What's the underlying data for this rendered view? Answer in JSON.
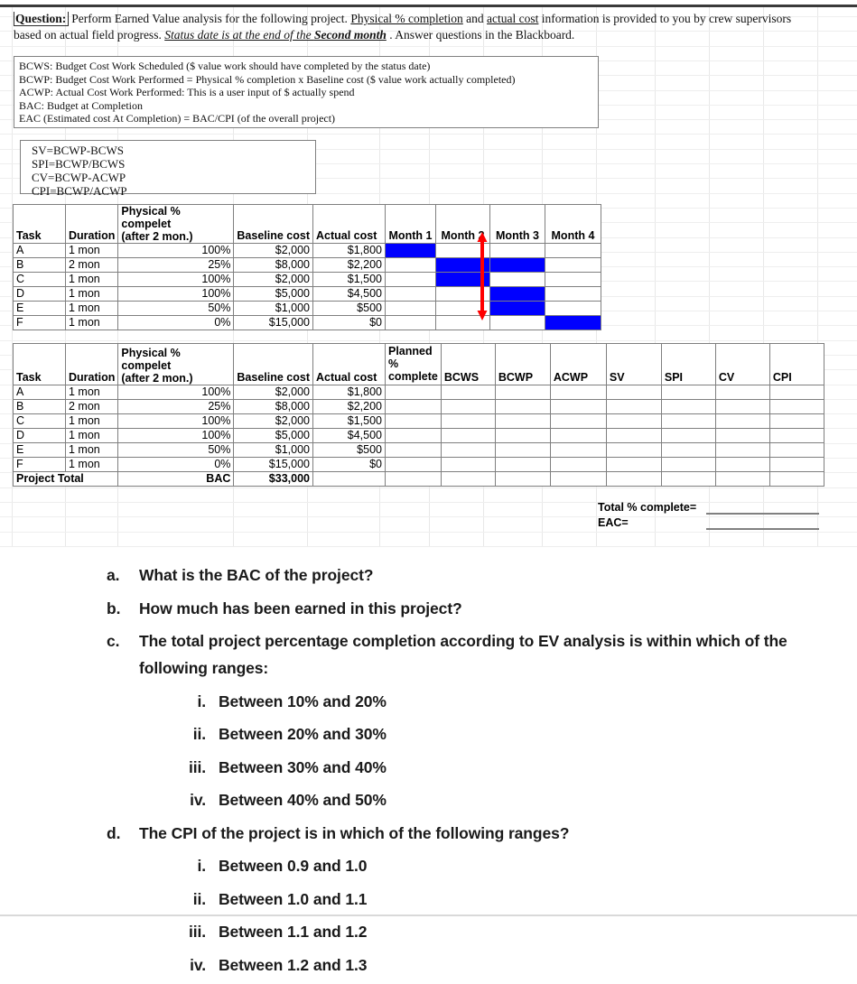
{
  "question": {
    "label": "Question:",
    "line1_a": "Perform Earned Value analysis for the following project. ",
    "line1_u1": "Physical % completion",
    "line1_b": " and ",
    "line1_u2": "actual cost",
    "line1_c": " information is provided to you by crew supervisors",
    "line2_a": "based on actual field progress. ",
    "line2_i1": "Status date is at the end of the ",
    "line2_i2": "Second month",
    "line2_b": " . Answer questions in the Blackboard."
  },
  "definitions": [
    "BCWS: Budget Cost Work Scheduled ($ value work should have completed by the status date)",
    "BCWP: Budget Cost Work Performed = Physical % completion x Baseline cost ($ value work actually completed)",
    "ACWP: Actual Cost Work Performed: This is a user input of $ actually spend",
    "BAC: Budget at Completion",
    "EAC (Estimated cost At Completion) = BAC/CPI (of the overall project)"
  ],
  "formulas": [
    "SV=BCWP-BCWS",
    "SPI=BCWP/BCWS",
    "CV=BCWP-ACWP",
    "CPI=BCWP/ACWP"
  ],
  "gantt_table": {
    "headers": {
      "task": "Task",
      "duration": "Duration",
      "pct_line1": "Physical % compelet",
      "pct_line2": "(after 2 mon.)",
      "baseline": "Baseline cost",
      "actual": "Actual cost",
      "months": [
        "Month 1",
        "Month 2",
        "Month 3",
        "Month 4"
      ]
    },
    "rows": [
      {
        "task": "A",
        "duration": "1 mon",
        "pct": "100%",
        "baseline": "$2,000",
        "actual": "$1,800",
        "bars": [
          true,
          false,
          false,
          false
        ]
      },
      {
        "task": "B",
        "duration": "2 mon",
        "pct": "25%",
        "baseline": "$8,000",
        "actual": "$2,200",
        "bars": [
          false,
          true,
          true,
          false
        ]
      },
      {
        "task": "C",
        "duration": "1 mon",
        "pct": "100%",
        "baseline": "$2,000",
        "actual": "$1,500",
        "bars": [
          false,
          true,
          false,
          false
        ]
      },
      {
        "task": "D",
        "duration": "1 mon",
        "pct": "100%",
        "baseline": "$5,000",
        "actual": "$4,500",
        "bars": [
          false,
          false,
          true,
          false
        ]
      },
      {
        "task": "E",
        "duration": "1 mon",
        "pct": "50%",
        "baseline": "$1,000",
        "actual": "$500",
        "bars": [
          false,
          false,
          true,
          false
        ]
      },
      {
        "task": "F",
        "duration": "1 mon",
        "pct": "0%",
        "baseline": "$15,000",
        "actual": "$0",
        "bars": [
          false,
          false,
          false,
          true
        ]
      }
    ],
    "bar_color": "#0000FF",
    "status_line_color": "#FF0000"
  },
  "ev_table": {
    "headers": {
      "task": "Task",
      "duration": "Duration",
      "pct_line1": "Physical % compelet",
      "pct_line2": "(after 2 mon.)",
      "baseline": "Baseline cost",
      "actual": "Actual cost",
      "planned_line1": "Planned",
      "planned_line2": "%",
      "planned_line3": "complete",
      "bcws": "BCWS",
      "bcwp": "BCWP",
      "acwp": "ACWP",
      "sv": "SV",
      "spi": "SPI",
      "cv": "CV",
      "cpi": "CPI"
    },
    "rows": [
      {
        "task": "A",
        "duration": "1 mon",
        "pct": "100%",
        "baseline": "$2,000",
        "actual": "$1,800"
      },
      {
        "task": "B",
        "duration": "2 mon",
        "pct": "25%",
        "baseline": "$8,000",
        "actual": "$2,200"
      },
      {
        "task": "C",
        "duration": "1 mon",
        "pct": "100%",
        "baseline": "$2,000",
        "actual": "$1,500"
      },
      {
        "task": "D",
        "duration": "1 mon",
        "pct": "100%",
        "baseline": "$5,000",
        "actual": "$4,500"
      },
      {
        "task": "E",
        "duration": "1 mon",
        "pct": "50%",
        "baseline": "$1,000",
        "actual": "$500"
      },
      {
        "task": "F",
        "duration": "1 mon",
        "pct": "0%",
        "baseline": "$15,000",
        "actual": "$0"
      }
    ],
    "total_row": {
      "label": "Project Total",
      "duration": "",
      "pct": "BAC",
      "baseline": "$33,000",
      "actual": ""
    }
  },
  "totals": {
    "total_pct_label": "Total % complete=",
    "eac_label": "EAC=",
    "total_pct_value": "",
    "eac_value": ""
  },
  "questions": [
    {
      "mark": "a.",
      "text": "What is the BAC of the project?",
      "level": 1
    },
    {
      "mark": "b.",
      "text": "How much has been earned in this project?",
      "level": 1
    },
    {
      "mark": "c.",
      "text": "The total project percentage completion according to EV analysis is within which of the following ranges:",
      "level": 1
    },
    {
      "mark": "i.",
      "text": "Between 10% and 20%",
      "level": 2
    },
    {
      "mark": "ii.",
      "text": "Between 20% and 30%",
      "level": 2
    },
    {
      "mark": "iii.",
      "text": "Between 30% and 40%",
      "level": 2
    },
    {
      "mark": "iv.",
      "text": "Between 40% and 50%",
      "level": 2
    },
    {
      "mark": "d.",
      "text": "The CPI of the project is in which of the following ranges?",
      "level": 1
    },
    {
      "mark": "i.",
      "text": "Between 0.9 and 1.0",
      "level": 2
    },
    {
      "mark": "ii.",
      "text": "Between 1.0 and 1.1",
      "level": 2
    },
    {
      "mark": "iii.",
      "text": "Between 1.1 and 1.2",
      "level": 2
    },
    {
      "mark": "iv.",
      "text": "Between 1.2 and 1.3",
      "level": 2
    }
  ]
}
